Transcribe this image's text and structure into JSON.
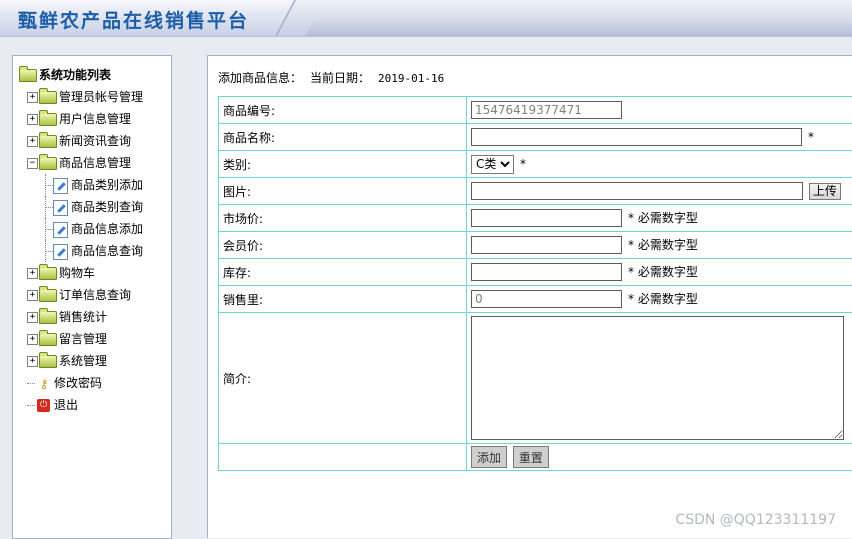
{
  "site_title": "甄鲜农产品在线销售平台",
  "sidebar": {
    "root_label": "系统功能列表",
    "items": [
      {
        "label": "管理员帐号管理"
      },
      {
        "label": "用户信息管理"
      },
      {
        "label": "新闻资讯查询"
      },
      {
        "label": "商品信息管理"
      },
      {
        "label": "商品类别添加"
      },
      {
        "label": "商品类别查询"
      },
      {
        "label": "商品信息添加"
      },
      {
        "label": "商品信息查询"
      },
      {
        "label": "购物车"
      },
      {
        "label": "订单信息查询"
      },
      {
        "label": "销售统计"
      },
      {
        "label": "留言管理"
      },
      {
        "label": "系统管理"
      },
      {
        "label": "修改密码"
      },
      {
        "label": "退出"
      }
    ]
  },
  "main": {
    "section_title": "添加商品信息：",
    "date_label": "当前日期：",
    "date_value": "2019-01-16",
    "form": {
      "code_label": "商品编号:",
      "code_value": "15476419377471",
      "name_label": "商品名称:",
      "name_value": "",
      "required_mark": "*",
      "category_label": "类别:",
      "category_selected": "C类",
      "image_label": "图片:",
      "image_value": "",
      "upload_button": "上传",
      "market_price_label": "市场价:",
      "member_price_label": "会员价:",
      "stock_label": "库存:",
      "sales_label": "销售里:",
      "sales_value": "0",
      "numeric_hint": "* 必需数字型",
      "intro_label": "简介:",
      "add_button": "添加",
      "reset_button": "重置"
    }
  },
  "watermark": "CSDN @QQ123311197"
}
